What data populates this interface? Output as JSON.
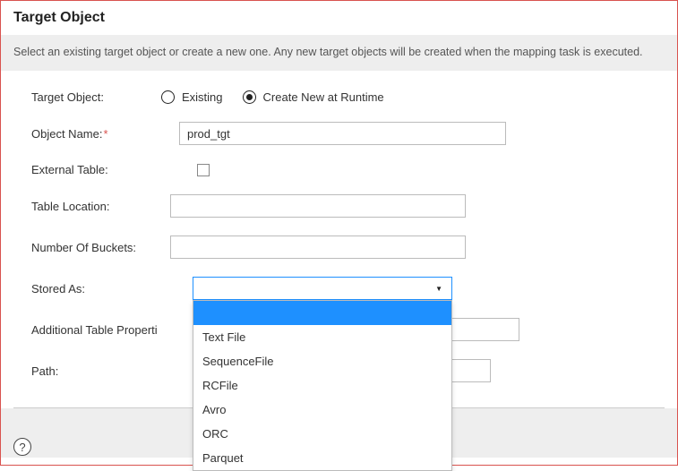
{
  "panel": {
    "title": "Target Object",
    "instructions": "Select an existing target object or create a new one. Any new target objects will be created when the mapping task is executed."
  },
  "form": {
    "targetObject": {
      "label": "Target Object:",
      "options": {
        "existing": "Existing",
        "createNew": "Create New at Runtime"
      },
      "selected": "createNew"
    },
    "objectName": {
      "label": "Object Name:",
      "value": "prod_tgt"
    },
    "externalTable": {
      "label": "External Table:",
      "checked": false
    },
    "tableLocation": {
      "label": "Table Location:",
      "value": ""
    },
    "numberOfBuckets": {
      "label": "Number Of Buckets:",
      "value": ""
    },
    "storedAs": {
      "label": "Stored As:",
      "value": "",
      "options": [
        "Text File",
        "SequenceFile",
        "RCFile",
        "Avro",
        "ORC",
        "Parquet"
      ]
    },
    "additionalTableProperties": {
      "label": "Additional Table Properti",
      "value": ""
    },
    "path": {
      "label": "Path:",
      "value": ""
    }
  },
  "helpTooltip": "?"
}
